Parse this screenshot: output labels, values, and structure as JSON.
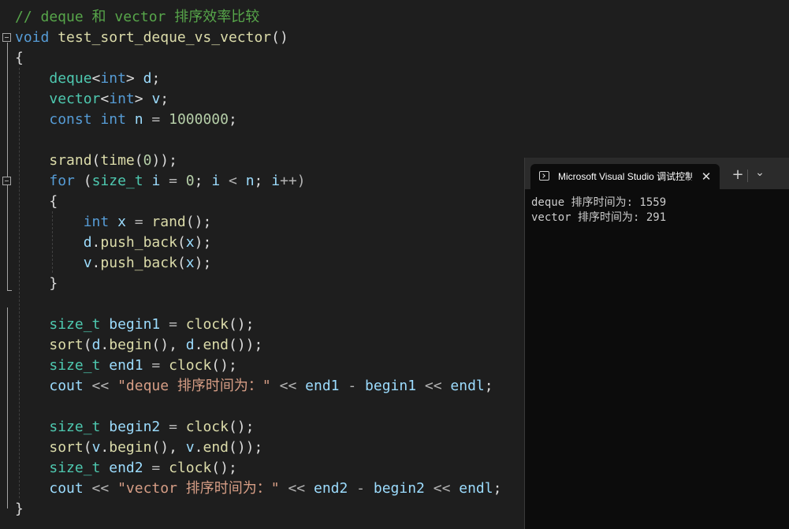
{
  "editor": {
    "lines": [
      [
        {
          "t": "// deque 和 vector 排序效率比较",
          "c": "comment"
        }
      ],
      [
        {
          "t": "void",
          "c": "kw"
        },
        {
          "t": " ",
          "c": "punc"
        },
        {
          "t": "test_sort_deque_vs_vector",
          "c": "fn"
        },
        {
          "t": "()",
          "c": "punc"
        }
      ],
      [
        {
          "t": "{",
          "c": "punc"
        }
      ],
      [
        {
          "t": "    ",
          "c": "punc"
        },
        {
          "t": "deque",
          "c": "type"
        },
        {
          "t": "<",
          "c": "punc"
        },
        {
          "t": "int",
          "c": "kw"
        },
        {
          "t": "> ",
          "c": "punc"
        },
        {
          "t": "d",
          "c": "var"
        },
        {
          "t": ";",
          "c": "punc"
        }
      ],
      [
        {
          "t": "    ",
          "c": "punc"
        },
        {
          "t": "vector",
          "c": "type"
        },
        {
          "t": "<",
          "c": "punc"
        },
        {
          "t": "int",
          "c": "kw"
        },
        {
          "t": "> ",
          "c": "punc"
        },
        {
          "t": "v",
          "c": "var"
        },
        {
          "t": ";",
          "c": "punc"
        }
      ],
      [
        {
          "t": "    ",
          "c": "punc"
        },
        {
          "t": "const",
          "c": "kw"
        },
        {
          "t": " ",
          "c": "punc"
        },
        {
          "t": "int",
          "c": "kw"
        },
        {
          "t": " ",
          "c": "punc"
        },
        {
          "t": "n",
          "c": "var"
        },
        {
          "t": " = ",
          "c": "op"
        },
        {
          "t": "1000000",
          "c": "num"
        },
        {
          "t": ";",
          "c": "punc"
        }
      ],
      [],
      [
        {
          "t": "    ",
          "c": "punc"
        },
        {
          "t": "srand",
          "c": "fn"
        },
        {
          "t": "(",
          "c": "punc"
        },
        {
          "t": "time",
          "c": "fn"
        },
        {
          "t": "(",
          "c": "punc"
        },
        {
          "t": "0",
          "c": "num"
        },
        {
          "t": "));",
          "c": "punc"
        }
      ],
      [
        {
          "t": "    ",
          "c": "punc"
        },
        {
          "t": "for",
          "c": "kw"
        },
        {
          "t": " (",
          "c": "punc"
        },
        {
          "t": "size_t",
          "c": "type"
        },
        {
          "t": " ",
          "c": "punc"
        },
        {
          "t": "i",
          "c": "var"
        },
        {
          "t": " = ",
          "c": "op"
        },
        {
          "t": "0",
          "c": "num"
        },
        {
          "t": "; ",
          "c": "punc"
        },
        {
          "t": "i",
          "c": "var"
        },
        {
          "t": " < ",
          "c": "op"
        },
        {
          "t": "n",
          "c": "var"
        },
        {
          "t": "; ",
          "c": "punc"
        },
        {
          "t": "i",
          "c": "var"
        },
        {
          "t": "++)",
          "c": "op"
        }
      ],
      [
        {
          "t": "    {",
          "c": "punc"
        }
      ],
      [
        {
          "t": "        ",
          "c": "punc"
        },
        {
          "t": "int",
          "c": "kw"
        },
        {
          "t": " ",
          "c": "punc"
        },
        {
          "t": "x",
          "c": "var"
        },
        {
          "t": " = ",
          "c": "op"
        },
        {
          "t": "rand",
          "c": "fn"
        },
        {
          "t": "();",
          "c": "punc"
        }
      ],
      [
        {
          "t": "        ",
          "c": "punc"
        },
        {
          "t": "d",
          "c": "var"
        },
        {
          "t": ".",
          "c": "punc"
        },
        {
          "t": "push_back",
          "c": "fn"
        },
        {
          "t": "(",
          "c": "punc"
        },
        {
          "t": "x",
          "c": "var"
        },
        {
          "t": ");",
          "c": "punc"
        }
      ],
      [
        {
          "t": "        ",
          "c": "punc"
        },
        {
          "t": "v",
          "c": "var"
        },
        {
          "t": ".",
          "c": "punc"
        },
        {
          "t": "push_back",
          "c": "fn"
        },
        {
          "t": "(",
          "c": "punc"
        },
        {
          "t": "x",
          "c": "var"
        },
        {
          "t": ");",
          "c": "punc"
        }
      ],
      [
        {
          "t": "    }",
          "c": "punc"
        }
      ],
      [],
      [
        {
          "t": "    ",
          "c": "punc"
        },
        {
          "t": "size_t",
          "c": "type"
        },
        {
          "t": " ",
          "c": "punc"
        },
        {
          "t": "begin1",
          "c": "var"
        },
        {
          "t": " = ",
          "c": "op"
        },
        {
          "t": "clock",
          "c": "fn"
        },
        {
          "t": "();",
          "c": "punc"
        }
      ],
      [
        {
          "t": "    ",
          "c": "punc"
        },
        {
          "t": "sort",
          "c": "fn"
        },
        {
          "t": "(",
          "c": "punc"
        },
        {
          "t": "d",
          "c": "var"
        },
        {
          "t": ".",
          "c": "punc"
        },
        {
          "t": "begin",
          "c": "fn"
        },
        {
          "t": "(), ",
          "c": "punc"
        },
        {
          "t": "d",
          "c": "var"
        },
        {
          "t": ".",
          "c": "punc"
        },
        {
          "t": "end",
          "c": "fn"
        },
        {
          "t": "());",
          "c": "punc"
        }
      ],
      [
        {
          "t": "    ",
          "c": "punc"
        },
        {
          "t": "size_t",
          "c": "type"
        },
        {
          "t": " ",
          "c": "punc"
        },
        {
          "t": "end1",
          "c": "var"
        },
        {
          "t": " = ",
          "c": "op"
        },
        {
          "t": "clock",
          "c": "fn"
        },
        {
          "t": "();",
          "c": "punc"
        }
      ],
      [
        {
          "t": "    ",
          "c": "punc"
        },
        {
          "t": "cout",
          "c": "var"
        },
        {
          "t": " << ",
          "c": "op"
        },
        {
          "t": "\"deque 排序时间为：\"",
          "c": "str"
        },
        {
          "t": " << ",
          "c": "op"
        },
        {
          "t": "end1",
          "c": "var"
        },
        {
          "t": " - ",
          "c": "op"
        },
        {
          "t": "begin1",
          "c": "var"
        },
        {
          "t": " << ",
          "c": "op"
        },
        {
          "t": "endl",
          "c": "var"
        },
        {
          "t": ";",
          "c": "punc"
        }
      ],
      [],
      [
        {
          "t": "    ",
          "c": "punc"
        },
        {
          "t": "size_t",
          "c": "type"
        },
        {
          "t": " ",
          "c": "punc"
        },
        {
          "t": "begin2",
          "c": "var"
        },
        {
          "t": " = ",
          "c": "op"
        },
        {
          "t": "clock",
          "c": "fn"
        },
        {
          "t": "();",
          "c": "punc"
        }
      ],
      [
        {
          "t": "    ",
          "c": "punc"
        },
        {
          "t": "sort",
          "c": "fn"
        },
        {
          "t": "(",
          "c": "punc"
        },
        {
          "t": "v",
          "c": "var"
        },
        {
          "t": ".",
          "c": "punc"
        },
        {
          "t": "begin",
          "c": "fn"
        },
        {
          "t": "(), ",
          "c": "punc"
        },
        {
          "t": "v",
          "c": "var"
        },
        {
          "t": ".",
          "c": "punc"
        },
        {
          "t": "end",
          "c": "fn"
        },
        {
          "t": "());",
          "c": "punc"
        }
      ],
      [
        {
          "t": "    ",
          "c": "punc"
        },
        {
          "t": "size_t",
          "c": "type"
        },
        {
          "t": " ",
          "c": "punc"
        },
        {
          "t": "end2",
          "c": "var"
        },
        {
          "t": " = ",
          "c": "op"
        },
        {
          "t": "clock",
          "c": "fn"
        },
        {
          "t": "();",
          "c": "punc"
        }
      ],
      [
        {
          "t": "    ",
          "c": "punc"
        },
        {
          "t": "cout",
          "c": "var"
        },
        {
          "t": " << ",
          "c": "op"
        },
        {
          "t": "\"vector 排序时间为：\"",
          "c": "str"
        },
        {
          "t": " << ",
          "c": "op"
        },
        {
          "t": "end2",
          "c": "var"
        },
        {
          "t": " - ",
          "c": "op"
        },
        {
          "t": "begin2",
          "c": "var"
        },
        {
          "t": " << ",
          "c": "op"
        },
        {
          "t": "endl",
          "c": "var"
        },
        {
          "t": ";",
          "c": "punc"
        }
      ],
      [
        {
          "t": "}",
          "c": "punc"
        }
      ]
    ]
  },
  "terminal": {
    "tab_icon": "terminal-icon",
    "tab_title": "Microsoft Visual Studio 调试控制台",
    "close_glyph": "✕",
    "new_tab_glyph": "+",
    "dropdown_glyph": "⌄",
    "output": [
      "deque 排序时间为: 1559",
      "vector 排序时间为: 291"
    ]
  },
  "colors": {
    "editor_bg": "#1e1e1e",
    "comment": "#57a64a",
    "keyword": "#569cd6",
    "type": "#4ec9b0",
    "function": "#dcdcaa",
    "variable": "#9cdcfe",
    "number": "#b5cea8",
    "string": "#d69d85",
    "terminal_bg": "#0c0c0c",
    "terminal_titlebar": "#2b2b2b"
  }
}
